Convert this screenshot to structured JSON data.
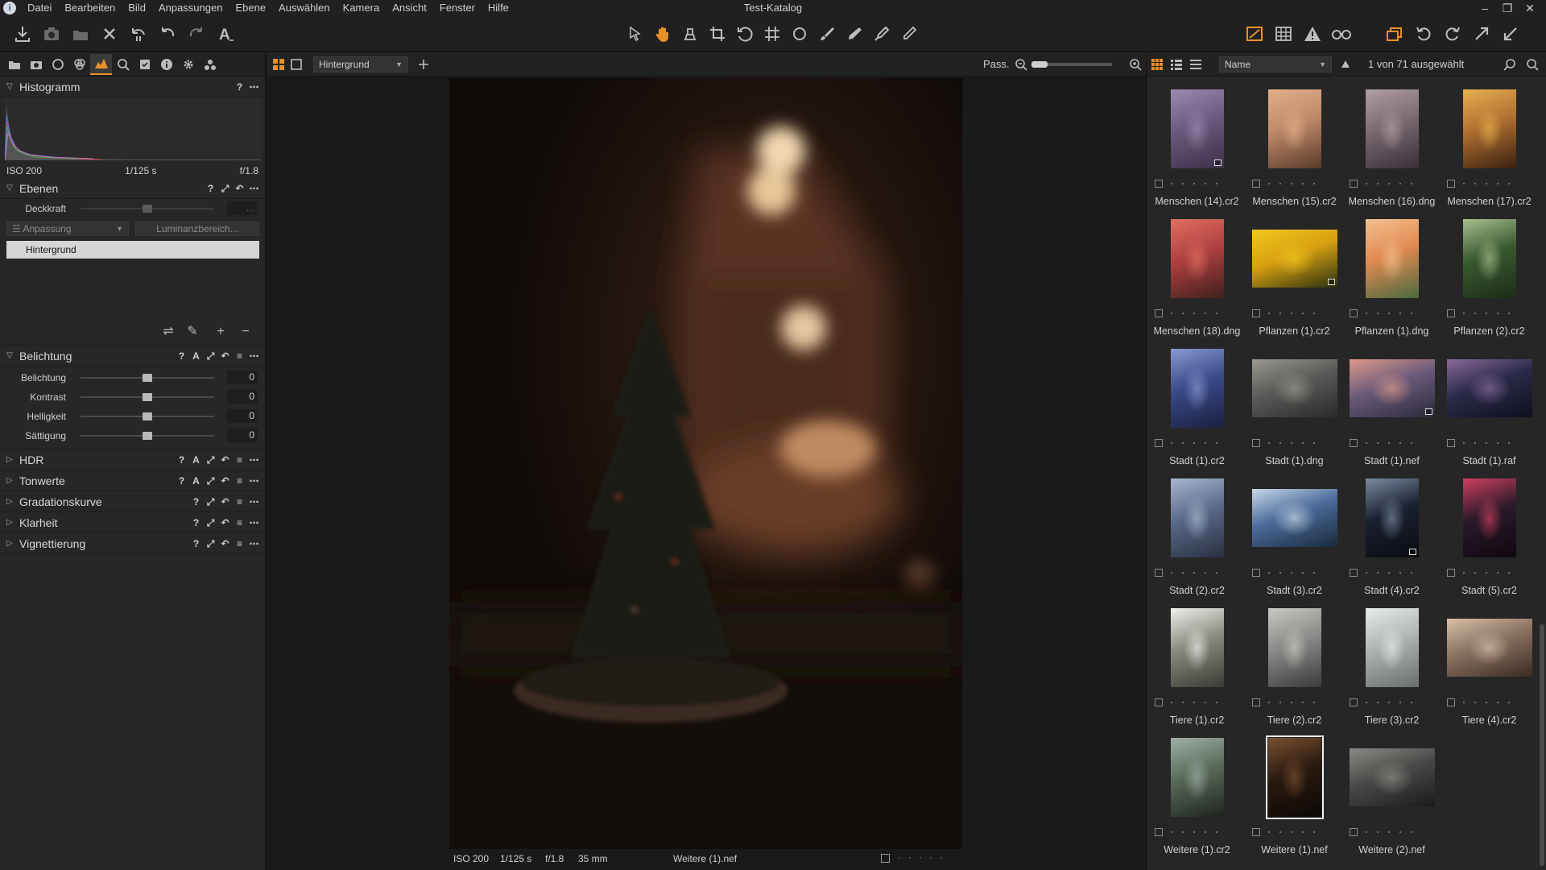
{
  "menu": {
    "app_icon": "capture-one-logo",
    "items": [
      "Datei",
      "Bearbeiten",
      "Bild",
      "Anpassungen",
      "Ebene",
      "Auswählen",
      "Kamera",
      "Ansicht",
      "Fenster",
      "Hilfe"
    ],
    "window_title": "Test-Katalog",
    "controls": [
      "minimize-icon",
      "restore-icon",
      "close-icon"
    ]
  },
  "toolbar": {
    "left_tools": [
      "import-icon",
      "capture-icon",
      "process-icon",
      "delete-icon",
      "undo-history-icon",
      "undo-icon",
      "redo-icon",
      "text-icon"
    ],
    "cursor_tools": [
      "select-cursor-icon",
      "pan-hand-icon",
      "loupe-icon",
      "crop-icon",
      "rotate-icon",
      "keystone-icon",
      "spot-icon",
      "brush-icon",
      "erase-icon",
      "picker-icon",
      "annotate-icon"
    ],
    "right_tools": [
      "exposure-warning-icon",
      "grid-icon",
      "warning-icon",
      "proof-glasses-icon",
      "multiple-views-icon",
      "rotate-left-icon",
      "rotate-right-icon",
      "expand-icon",
      "collapse-icon"
    ],
    "active_color": "#e8902a"
  },
  "tool_tabs": [
    "library-tab-icon",
    "capture-tab-icon",
    "lens-tab-icon",
    "color-tab-icon",
    "exposure-tab-icon",
    "details-tab-icon",
    "adjustments-tab-icon",
    "metadata-tab-icon",
    "settings-tab-icon",
    "output-tab-icon"
  ],
  "histogram": {
    "title": "Histogramm",
    "iso": "ISO 200",
    "shutter": "1/125 s",
    "aperture": "f/1.8"
  },
  "layers": {
    "title": "Ebenen",
    "opacity_label": "Deckkraft",
    "opacity_value": "...",
    "adjust_dd": "Anpassung",
    "luminance_dd": "Luminanzbereich...",
    "layer_name": "Hintergrund"
  },
  "exposure": {
    "title": "Belichtung",
    "sliders": [
      {
        "label": "Belichtung",
        "value": "0",
        "level": 0.5
      },
      {
        "label": "Kontrast",
        "value": "0",
        "level": 0.5
      },
      {
        "label": "Helligkeit",
        "value": "0",
        "level": 0.5
      },
      {
        "label": "Sättigung",
        "value": "0",
        "level": 0.5
      }
    ]
  },
  "collapsed_sections": [
    {
      "title": "HDR",
      "has_auto": true
    },
    {
      "title": "Tonwerte",
      "has_auto": true
    },
    {
      "title": "Gradationskurve",
      "has_auto": false
    },
    {
      "title": "Klarheit",
      "has_auto": false
    },
    {
      "title": "Vignettierung",
      "has_auto": false
    }
  ],
  "viewer": {
    "variant": "Hintergrund",
    "fit_label": "Pass.",
    "zoom_level": 0.2,
    "status": {
      "iso": "ISO 200",
      "shutter": "1/125 s",
      "aperture": "f/1.8",
      "focal": "35 mm",
      "filename": "Weitere (1).nef"
    }
  },
  "browser": {
    "sort_by": "Name",
    "selection": "1 von 71 ausgewählt",
    "items": [
      {
        "name": "Menschen (14).cr2",
        "orient": "portrait",
        "palette": [
          "#6a5a7e",
          "#9b8bb0",
          "#3c3048"
        ],
        "badge": true
      },
      {
        "name": "Menschen (15).cr2",
        "orient": "portrait",
        "palette": [
          "#c08a6a",
          "#e2b08a",
          "#5a3a2a"
        ],
        "badge": false
      },
      {
        "name": "Menschen (16).dng",
        "orient": "portrait",
        "palette": [
          "#7a6a72",
          "#b0a0a4",
          "#3a3038"
        ],
        "badge": false
      },
      {
        "name": "Menschen (17).cr2",
        "orient": "portrait",
        "palette": [
          "#b07030",
          "#e8b050",
          "#3a2010"
        ],
        "badge": false
      },
      {
        "name": "Menschen (18).dng",
        "orient": "portrait",
        "palette": [
          "#b04040",
          "#e07060",
          "#40201c"
        ],
        "badge": false
      },
      {
        "name": "Pflanzen (1).cr2",
        "orient": "landscape",
        "palette": [
          "#d8a010",
          "#f0c820",
          "#283010"
        ],
        "badge": true
      },
      {
        "name": "Pflanzen (1).dng",
        "orient": "portrait",
        "palette": [
          "#e08a50",
          "#f4c090",
          "#4a6a40"
        ],
        "badge": false
      },
      {
        "name": "Pflanzen (2).cr2",
        "orient": "portrait",
        "palette": [
          "#3a5a30",
          "#a8c090",
          "#1c2c18"
        ],
        "badge": false
      },
      {
        "name": "Stadt (1).cr2",
        "orient": "portrait",
        "palette": [
          "#3a4a8a",
          "#8a9ad0",
          "#1a2040"
        ],
        "badge": false
      },
      {
        "name": "Stadt (1).dng",
        "orient": "landscape",
        "palette": [
          "#5a5a58",
          "#9a9890",
          "#2a2a28"
        ],
        "badge": false
      },
      {
        "name": "Stadt (1).nef",
        "orient": "landscape",
        "palette": [
          "#6a5a7a",
          "#e09a8a",
          "#2a2a3a"
        ],
        "badge": true
      },
      {
        "name": "Stadt (1).raf",
        "orient": "landscape",
        "palette": [
          "#2a2a48",
          "#8a6a9a",
          "#101020"
        ],
        "badge": false
      },
      {
        "name": "Stadt (2).cr2",
        "orient": "portrait",
        "palette": [
          "#5a6a8a",
          "#a8b8d0",
          "#2a3040"
        ],
        "badge": false
      },
      {
        "name": "Stadt (3).cr2",
        "orient": "landscape",
        "palette": [
          "#4a6a9a",
          "#c8d8e8",
          "#1a2a3a"
        ],
        "badge": false
      },
      {
        "name": "Stadt (4).cr2",
        "orient": "portrait",
        "palette": [
          "#1a2030",
          "#7a8aa0",
          "#0a0c10"
        ],
        "badge": true
      },
      {
        "name": "Stadt (5).cr2",
        "orient": "portrait",
        "palette": [
          "#2a1a2a",
          "#d04060",
          "#100810"
        ],
        "badge": false
      },
      {
        "name": "Tiere (1).cr2",
        "orient": "portrait",
        "palette": [
          "#8a8a80",
          "#f0f0ec",
          "#3a3a34"
        ],
        "badge": false
      },
      {
        "name": "Tiere (2).cr2",
        "orient": "portrait",
        "palette": [
          "#8a8a88",
          "#c8c8c4",
          "#3a3a38"
        ],
        "badge": false
      },
      {
        "name": "Tiere (3).cr2",
        "orient": "portrait",
        "palette": [
          "#b0b4b0",
          "#e8ece8",
          "#6a6e6a"
        ],
        "badge": false
      },
      {
        "name": "Tiere (4).cr2",
        "orient": "landscape",
        "palette": [
          "#8a7060",
          "#d8c0a8",
          "#3a2c24"
        ],
        "badge": false
      },
      {
        "name": "Weitere (1).cr2",
        "orient": "portrait",
        "palette": [
          "#5a6a5a",
          "#a0b0a8",
          "#1e2420"
        ],
        "badge": false
      },
      {
        "name": "Weitere (1).nef",
        "orient": "portrait",
        "palette": [
          "#2a1a10",
          "#7a5030",
          "#0c0806"
        ],
        "badge": false,
        "selected": true
      },
      {
        "name": "Weitere (2).nef",
        "orient": "landscape",
        "palette": [
          "#4a4a48",
          "#8a8a86",
          "#1a1a1a"
        ],
        "badge": false
      }
    ]
  }
}
